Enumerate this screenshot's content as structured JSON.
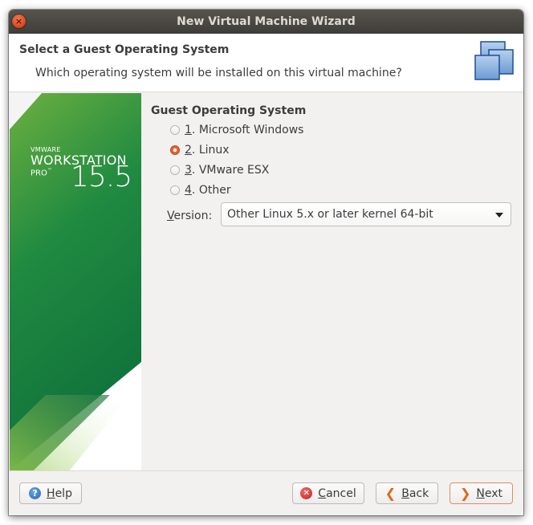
{
  "window": {
    "title": "New Virtual Machine Wizard",
    "close_glyph": "×"
  },
  "header": {
    "title": "Select a Guest Operating System",
    "subtitle": "Which operating system will be installed on this virtual machine?",
    "icon": "virtual-machines-icon"
  },
  "banner": {
    "brand_small": "VMWARE",
    "brand_product": "WORKSTATION",
    "brand_edition": "PRO",
    "brand_tm": "™",
    "version": "15.5"
  },
  "guest_os": {
    "group_label": "Guest Operating System",
    "options": [
      {
        "mnemonic": "1",
        "label": ". Microsoft Windows",
        "selected": false
      },
      {
        "mnemonic": "2",
        "label": ". Linux",
        "selected": true
      },
      {
        "mnemonic": "3",
        "label": ". VMware ESX",
        "selected": false
      },
      {
        "mnemonic": "4",
        "label": ". Other",
        "selected": false
      }
    ],
    "version_label_mnemonic": "V",
    "version_label_rest": "ersion:",
    "version_value": "Other Linux 5.x or later kernel 64-bit"
  },
  "footer": {
    "help": {
      "mnemonic": "H",
      "rest": "elp",
      "icon": "help-icon",
      "glyph": "?"
    },
    "cancel": {
      "mnemonic": "C",
      "rest": "ancel",
      "icon": "cancel-icon",
      "glyph": "✕"
    },
    "back": {
      "mnemonic": "B",
      "rest": "ack",
      "icon": "chevron-left-icon",
      "glyph": "❮"
    },
    "next": {
      "mnemonic": "N",
      "rest": "ext",
      "icon": "chevron-right-icon",
      "glyph": "❯"
    }
  },
  "colors": {
    "accent": "#e2602f",
    "banner_green": "#10713b",
    "banner_light_green": "#6fb33f"
  }
}
